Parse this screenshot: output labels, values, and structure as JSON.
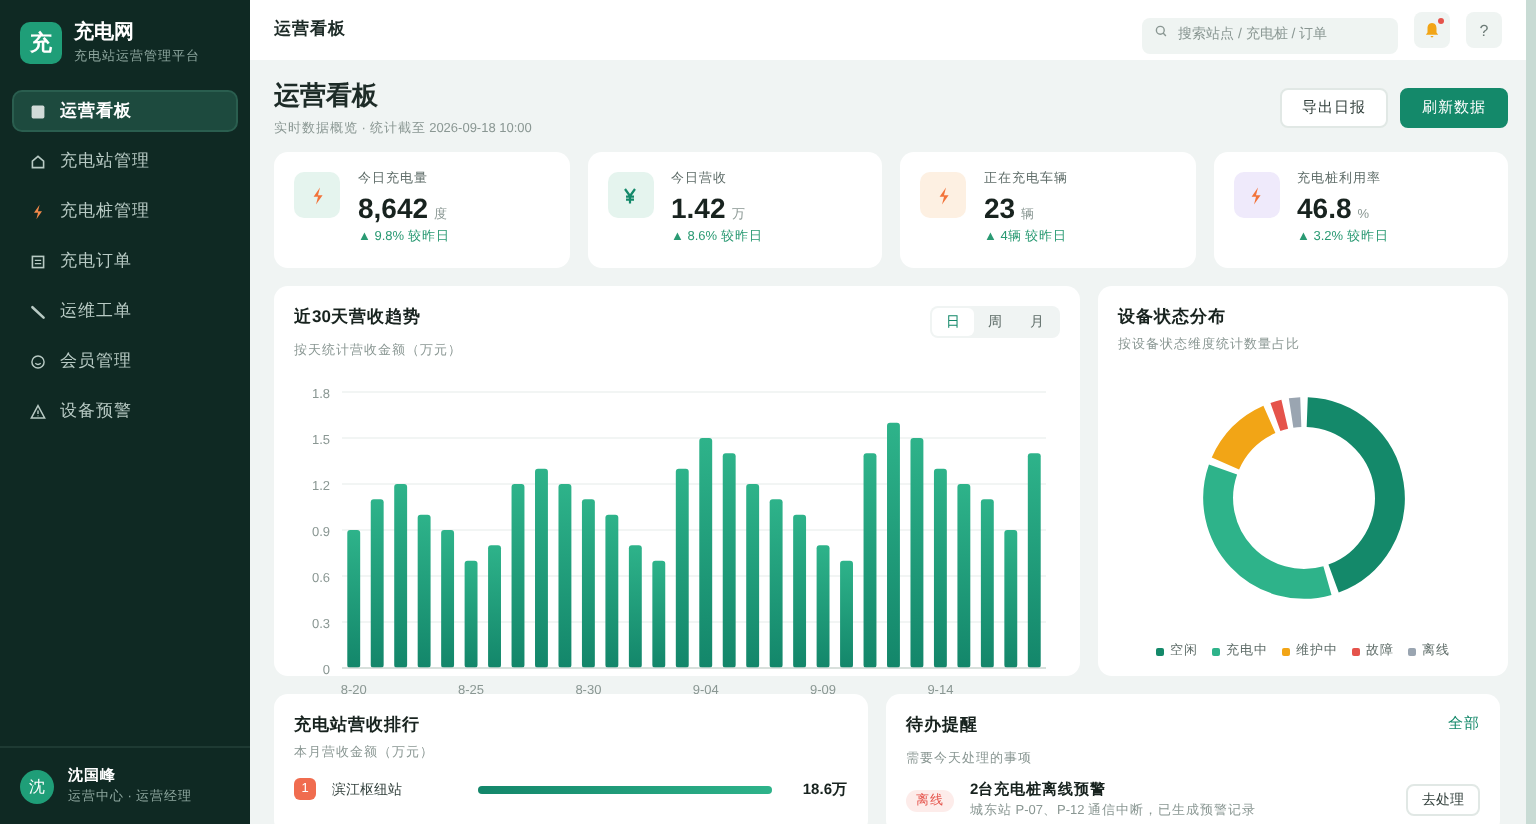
{
  "sidebar": {
    "logo": "充",
    "title": "充电网",
    "subtitle": "充电站运营管理平台",
    "items": [
      {
        "label": "运营看板",
        "kind": "dashboard",
        "selected": true
      },
      {
        "label": "充电站管理",
        "kind": "stations",
        "selected": false
      },
      {
        "label": "充电桩管理",
        "kind": "chargers",
        "selected": false
      },
      {
        "label": "充电订单",
        "kind": "orders",
        "selected": false
      },
      {
        "label": "运维工单",
        "kind": "tickets",
        "selected": false
      },
      {
        "label": "会员管理",
        "kind": "members",
        "selected": false
      },
      {
        "label": "设备预警",
        "kind": "alerts",
        "selected": false
      }
    ],
    "user": {
      "avatar": "沈",
      "name": "沈国峰",
      "role": "运营中心 · 运营经理"
    }
  },
  "topbar": {
    "breadcrumb": "运营看板",
    "search": {
      "placeholder": "搜索站点 / 充电桩 / 订单"
    },
    "notification": true,
    "help": "?"
  },
  "header": {
    "title": "运营看板",
    "subtitle": "实时数据概览 · 统计截至 2026-09-18 10:00",
    "buttons": [
      {
        "label": "导出日报",
        "kind": "secondary"
      },
      {
        "label": "刷新数据",
        "kind": "primary"
      }
    ]
  },
  "kpis": [
    {
      "label": "今日充电量",
      "value": "8,642",
      "unit": "度",
      "trend": "▲ 9.8% 较昨日",
      "kind": "energy",
      "color": "#e5f4ee"
    },
    {
      "label": "今日营收",
      "value": "1.42",
      "unit": "万",
      "trend": "▲ 8.6% 较昨日",
      "kind": "revenue",
      "color": "#e5f4ee"
    },
    {
      "label": "正在充电车辆",
      "value": "23",
      "unit": "辆",
      "trend": "▲ 4辆 较昨日",
      "kind": "vehicles",
      "color": "#fdf0e2"
    },
    {
      "label": "充电桩利用率",
      "value": "46.8",
      "unit": "%",
      "trend": "▲ 3.2% 较昨日",
      "kind": "utilization",
      "color": "#efeafb"
    }
  ],
  "revenue_trend": {
    "title": "近30天营收趋势",
    "subtitle": "按天统计营收金额（万元）",
    "periods": [
      {
        "label": "日",
        "selected": true
      },
      {
        "label": "周",
        "selected": false
      },
      {
        "label": "月",
        "selected": false
      }
    ],
    "chart_data": {
      "type": "bar",
      "categories": [
        "8-20",
        null,
        null,
        null,
        null,
        "8-25",
        null,
        null,
        null,
        null,
        "8-30",
        null,
        null,
        null,
        null,
        "9-04",
        null,
        null,
        null,
        null,
        "9-09",
        null,
        null,
        null,
        null,
        "9-14",
        null,
        null,
        null,
        null
      ],
      "values": [
        0.9,
        1.1,
        1.2,
        1.0,
        0.9,
        0.7,
        0.8,
        1.2,
        1.3,
        1.2,
        1.1,
        1.0,
        0.8,
        0.7,
        1.3,
        1.5,
        1.4,
        1.2,
        1.1,
        1.0,
        0.8,
        0.7,
        1.4,
        1.6,
        1.5,
        1.3,
        1.2,
        1.1,
        0.9,
        1.4
      ],
      "ylim": [
        0,
        1.8
      ],
      "yticks": [
        0,
        0.3,
        0.6,
        0.9,
        1.2,
        1.5,
        1.8
      ],
      "grid": true
    }
  },
  "device_status": {
    "title": "设备状态分布",
    "subtitle": "按设备状态维度统计数量占比",
    "legend": [
      {
        "label": "空闲",
        "color": "#14896a"
      },
      {
        "label": "充电中",
        "color": "#2eb38a"
      },
      {
        "label": "维护中",
        "color": "#f2a516"
      },
      {
        "label": "故障",
        "color": "#e5534b"
      },
      {
        "label": "离线",
        "color": "#9aa5b1"
      }
    ]
  },
  "station_ranking": {
    "title": "充电站营收排行",
    "subtitle": "本月营收金额（万元）",
    "rows": [
      {
        "rank": "1",
        "name": "滨江枢纽站",
        "level": 1.0,
        "value": "18.6万"
      }
    ]
  },
  "todo": {
    "title": "待办提醒",
    "subtitle": "需要今天处理的事项",
    "link": "全部",
    "items": [
      {
        "tag": "离线",
        "title": "2台充电桩离线预警",
        "description": "城东站 P-07、P-12 通信中断，已生成预警记录",
        "action": "去处理"
      }
    ]
  }
}
